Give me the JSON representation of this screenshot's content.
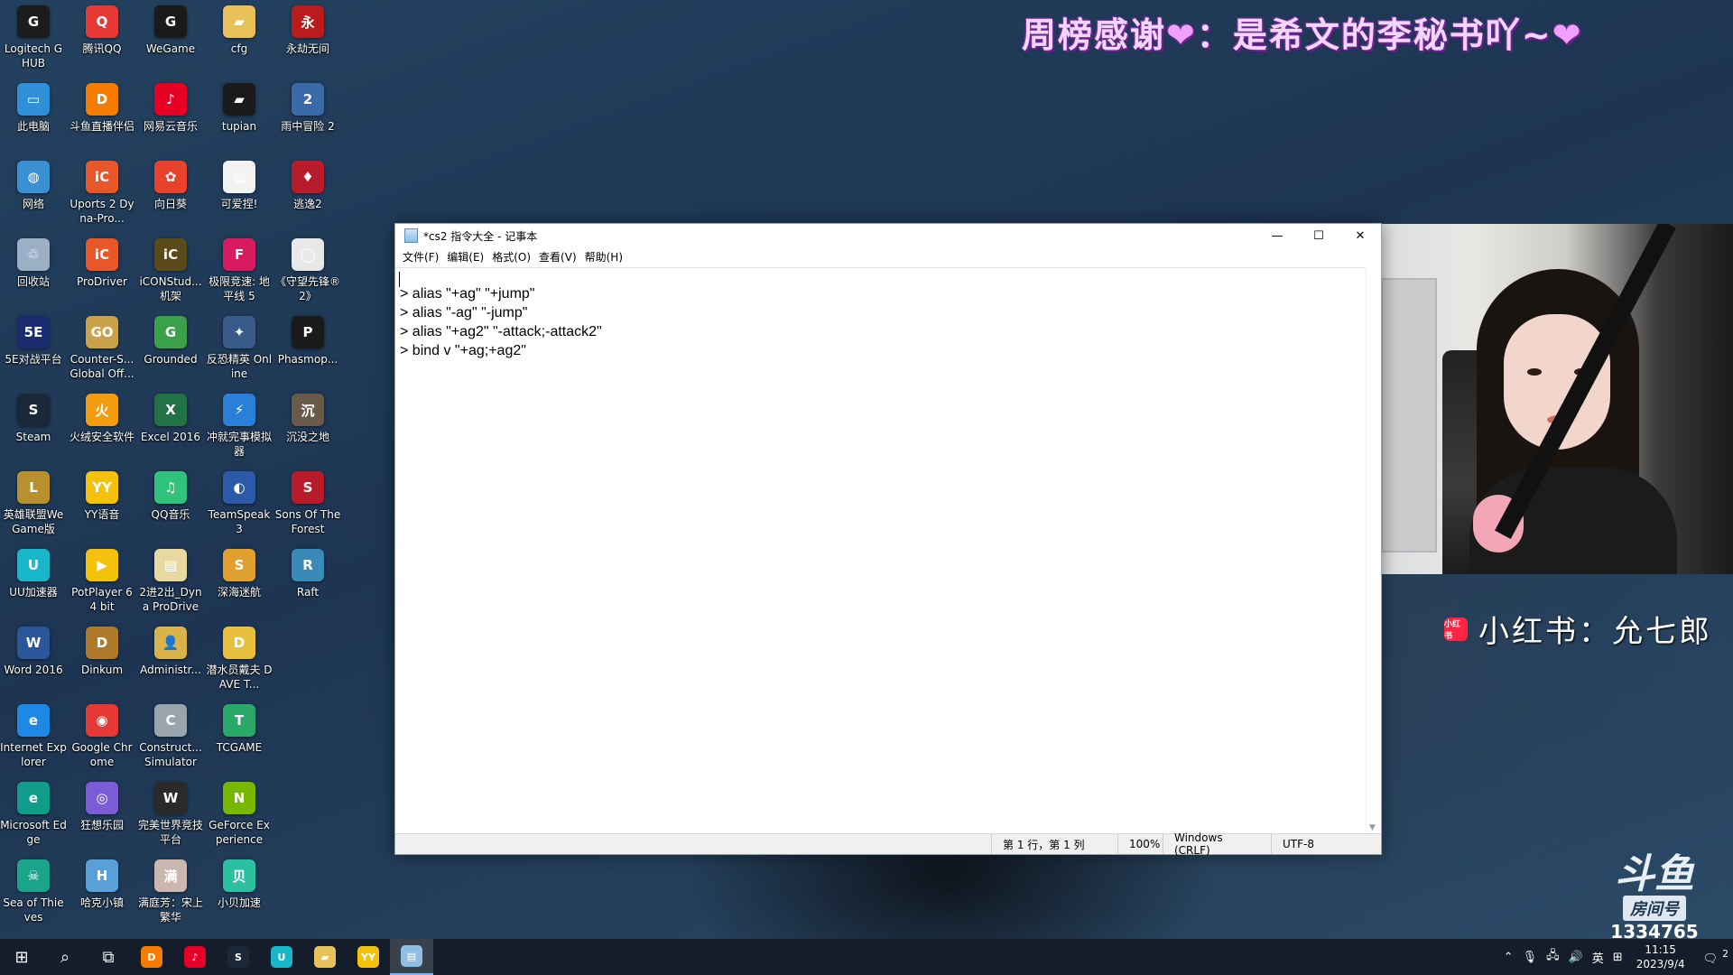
{
  "overlay": {
    "stream_title_prefix": "周榜感谢",
    "heart": "❤",
    "stream_title_main": "：是希文的李秘书吖~",
    "xhs_logo": "小红书",
    "xhs_text": "小红书：允七郎",
    "douyu_logo": "斗鱼",
    "douyu_room_label": "房间号",
    "douyu_room_number": "1334765"
  },
  "desktop_icons": [
    {
      "label": "Logitech G HUB",
      "glyph": "G",
      "color": "#1c1c1c"
    },
    {
      "label": "此电脑",
      "glyph": "▭",
      "color": "#2f8fd8"
    },
    {
      "label": "网络",
      "glyph": "◍",
      "color": "#3b8fd3"
    },
    {
      "label": "回收站",
      "glyph": "♲",
      "color": "#9bb0c4"
    },
    {
      "label": "5E对战平台",
      "glyph": "5E",
      "color": "#1a2c6e"
    },
    {
      "label": "Steam",
      "glyph": "S",
      "color": "#1b2838"
    },
    {
      "label": "英雄联盟WeGame版",
      "glyph": "L",
      "color": "#b8902e"
    },
    {
      "label": "UU加速器",
      "glyph": "U",
      "color": "#17b6c9"
    },
    {
      "label": "Word 2016",
      "glyph": "W",
      "color": "#2b579a"
    },
    {
      "label": "Internet Explorer",
      "glyph": "e",
      "color": "#1e88e5"
    },
    {
      "label": "Microsoft Edge",
      "glyph": "e",
      "color": "#0f9d8a"
    },
    {
      "label": "Sea of Thieves",
      "glyph": "☠",
      "color": "#1aa58a"
    },
    {
      "label": "腾讯QQ",
      "glyph": "Q",
      "color": "#e53935"
    },
    {
      "label": "斗鱼直播伴侣",
      "glyph": "D",
      "color": "#f57c00"
    },
    {
      "label": "Uports 2 Dyna-Pro...",
      "glyph": "iC",
      "color": "#e8572a"
    },
    {
      "label": "ProDriver",
      "glyph": "iC",
      "color": "#e8572a"
    },
    {
      "label": "Counter-S... Global Off...",
      "glyph": "GO",
      "color": "#c9a24a"
    },
    {
      "label": "火绒安全软件",
      "glyph": "火",
      "color": "#f39c12"
    },
    {
      "label": "YY语音",
      "glyph": "YY",
      "color": "#f4c20d"
    },
    {
      "label": "PotPlayer 64 bit",
      "glyph": "▶",
      "color": "#f4c20d"
    },
    {
      "label": "Dinkum",
      "glyph": "D",
      "color": "#b07a2c"
    },
    {
      "label": "Google Chrome",
      "glyph": "◉",
      "color": "#e53935"
    },
    {
      "label": "狂想乐园",
      "glyph": "◎",
      "color": "#7b5cd6"
    },
    {
      "label": "哈克小镇",
      "glyph": "H",
      "color": "#5aa0d8"
    },
    {
      "label": "WeGame",
      "glyph": "G",
      "color": "#1a1a1a"
    },
    {
      "label": "网易云音乐",
      "glyph": "♪",
      "color": "#e60026"
    },
    {
      "label": "向日葵",
      "glyph": "✿",
      "color": "#e8412c"
    },
    {
      "label": "iCONStud... 机架",
      "glyph": "iC",
      "color": "#5a4a1a"
    },
    {
      "label": "Grounded",
      "glyph": "G",
      "color": "#3aa14a"
    },
    {
      "label": "Excel 2016",
      "glyph": "X",
      "color": "#217346"
    },
    {
      "label": "QQ音乐",
      "glyph": "♫",
      "color": "#31c27c"
    },
    {
      "label": "2进2出_Dyna ProDrive 4...",
      "glyph": "▤",
      "color": "#e8d9a0"
    },
    {
      "label": "Administr...",
      "glyph": "👤",
      "color": "#d9b24c"
    },
    {
      "label": "Construct... Simulator",
      "glyph": "C",
      "color": "#9aa4ad"
    },
    {
      "label": "完美世界竞技平台",
      "glyph": "W",
      "color": "#2a2a2a"
    },
    {
      "label": "满庭芳：宋上繁华",
      "glyph": "满",
      "color": "#c9b7b0"
    },
    {
      "label": "cfg",
      "glyph": "▰",
      "color": "#e8c15a"
    },
    {
      "label": "tupian",
      "glyph": "▰",
      "color": "#1a1a1a"
    },
    {
      "label": "可爱捏!",
      "glyph": "▤",
      "color": "#f2f2f2"
    },
    {
      "label": "极限竞速: 地平线 5",
      "glyph": "F",
      "color": "#d81b60"
    },
    {
      "label": "反恐精英 Online",
      "glyph": "✦",
      "color": "#3a5a8a"
    },
    {
      "label": "冲就完事模拟器",
      "glyph": "⚡",
      "color": "#2a7fd8"
    },
    {
      "label": "TeamSpeak 3",
      "glyph": "◐",
      "color": "#2a5aa8"
    },
    {
      "label": "深海迷航",
      "glyph": "S",
      "color": "#e0a030"
    },
    {
      "label": "潜水员戴夫 DAVE T...",
      "glyph": "D",
      "color": "#e8c040"
    },
    {
      "label": "TCGAME",
      "glyph": "T",
      "color": "#2aa86a"
    },
    {
      "label": "GeForce Experience",
      "glyph": "N",
      "color": "#76b900"
    },
    {
      "label": "小贝加速",
      "glyph": "贝",
      "color": "#2ac0a0"
    },
    {
      "label": "永劫无间",
      "glyph": "永",
      "color": "#b81c1c"
    },
    {
      "label": "雨中冒险 2",
      "glyph": "2",
      "color": "#3a6aa8"
    },
    {
      "label": "逃逸2",
      "glyph": "♦",
      "color": "#b81c2a"
    },
    {
      "label": "《守望先锋®2》",
      "glyph": "◯",
      "color": "#e8e8e8"
    },
    {
      "label": "Phasmop...",
      "glyph": "P",
      "color": "#1a1a1a"
    },
    {
      "label": "沉没之地",
      "glyph": "沉",
      "color": "#6a5a4a"
    },
    {
      "label": "Sons Of The Forest",
      "glyph": "S",
      "color": "#b81c2a"
    },
    {
      "label": "Raft",
      "glyph": "R",
      "color": "#3a8ab8"
    }
  ],
  "notepad": {
    "title": "*cs2 指令大全 - 记事本",
    "menu": [
      "文件(F)",
      "编辑(E)",
      "格式(O)",
      "查看(V)",
      "帮助(H)"
    ],
    "lines": [
      "> alias \"+ag\" \"+jump\"",
      "> alias \"-ag\" \"-jump\"",
      "> alias \"+ag2\" \"-attack;-attack2\"",
      "> bind v \"+ag;+ag2\""
    ],
    "status": {
      "position": "第 1 行，第 1 列",
      "zoom": "100%",
      "line_ending": "Windows (CRLF)",
      "encoding": "UTF-8"
    }
  },
  "taskbar": {
    "apps": [
      {
        "name": "斗鱼直播伴侣",
        "glyph": "D",
        "color": "#f57c00"
      },
      {
        "name": "网易云音乐",
        "glyph": "♪",
        "color": "#e60026"
      },
      {
        "name": "Steam",
        "glyph": "S",
        "color": "#1b2838"
      },
      {
        "name": "UU加速器",
        "glyph": "U",
        "color": "#17b6c9"
      },
      {
        "name": "文件",
        "glyph": "▰",
        "color": "#e8c15a"
      },
      {
        "name": "YY语音",
        "glyph": "YY",
        "color": "#f4c20d"
      },
      {
        "name": "记事本",
        "glyph": "▤",
        "color": "#8fbde3"
      }
    ],
    "ime": "英",
    "time": "11:15",
    "date": "2023/9/4",
    "notification_count": "2"
  }
}
